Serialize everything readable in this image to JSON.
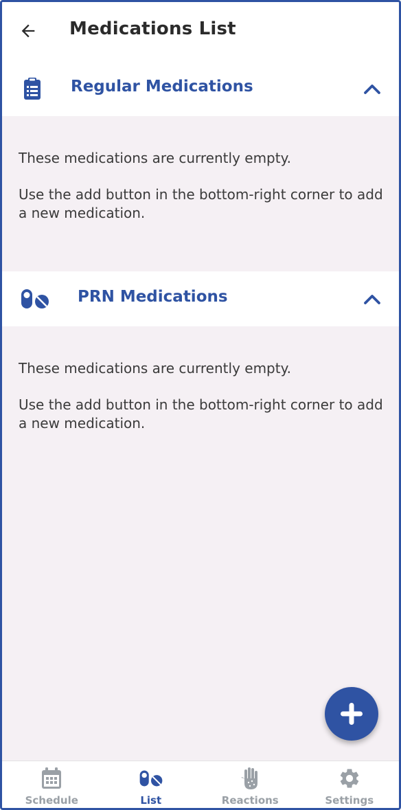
{
  "header": {
    "title": "Medications List",
    "back_icon": "arrow-left-icon"
  },
  "sections": [
    {
      "title": "Regular Medications",
      "icon": "clipboard-list-icon",
      "expanded": true,
      "empty_line1": "These medications are currently empty.",
      "empty_line2": "Use the add button in the bottom-right corner to add a new medication."
    },
    {
      "title": "PRN Medications",
      "icon": "pills-icon",
      "expanded": true,
      "empty_line1": "These medications are currently empty.",
      "empty_line2": "Use the add button in the bottom-right corner to add a new medication."
    }
  ],
  "fab": {
    "icon": "plus-icon"
  },
  "bottom_nav": {
    "items": [
      {
        "label": "Schedule",
        "icon": "calendar-icon",
        "active": false
      },
      {
        "label": "List",
        "icon": "pills-icon",
        "active": true
      },
      {
        "label": "Reactions",
        "icon": "hand-icon",
        "active": false
      },
      {
        "label": "Settings",
        "icon": "gear-icon",
        "active": false
      }
    ]
  },
  "colors": {
    "primary": "#2f53a3",
    "background": "#f5f0f4",
    "inactive": "#9aa0a6",
    "text": "#3a3a3a"
  }
}
